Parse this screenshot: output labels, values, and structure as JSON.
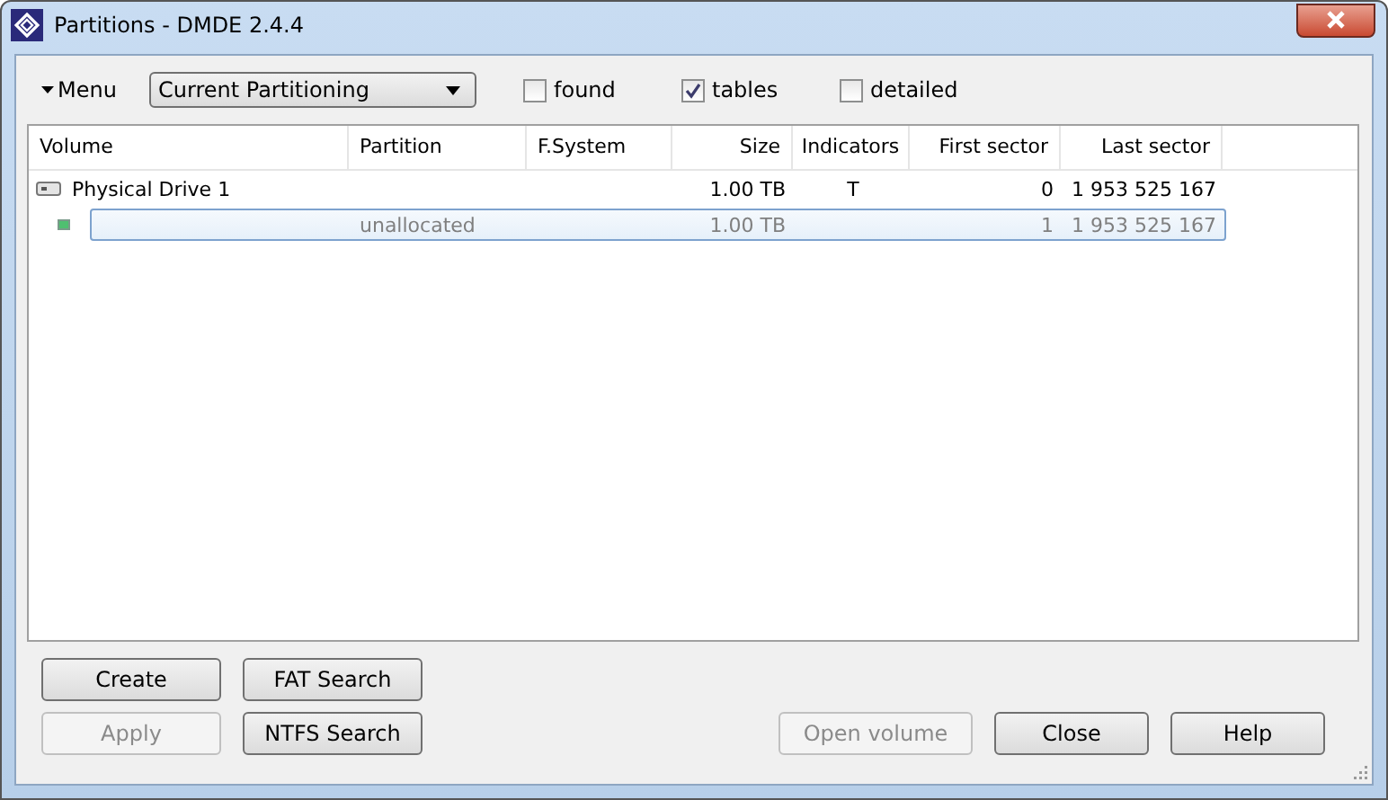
{
  "window": {
    "title": "Partitions - DMDE 2.4.4"
  },
  "toolbar": {
    "menu": "Menu",
    "view": "Current Partitioning",
    "checkboxes": [
      {
        "label": "found",
        "checked": false
      },
      {
        "label": "tables",
        "checked": true
      },
      {
        "label": "detailed",
        "checked": false
      }
    ]
  },
  "table": {
    "columns": [
      "Volume",
      "Partition",
      "F.System",
      "Size",
      "Indicators",
      "First sector",
      "Last sector"
    ],
    "rows": [
      {
        "kind": "drive",
        "selected": false,
        "disabled": false,
        "cells": [
          "Physical Drive 1",
          "",
          "",
          "1.00 TB",
          "T",
          "0",
          "1 953 525 167"
        ],
        "children": [
          {
            "kind": "free",
            "selected": true,
            "disabled": true,
            "cells": [
              "",
              "unallocated",
              "",
              "1.00 TB",
              "",
              "1",
              "1 953 525 167"
            ]
          }
        ]
      }
    ]
  },
  "left_buttons": [
    {
      "label": "Create",
      "disabled": false
    },
    {
      "label": "FAT Search",
      "disabled": false
    },
    {
      "label": "Apply",
      "disabled": true
    },
    {
      "label": "NTFS Search",
      "disabled": false
    }
  ],
  "right_buttons": [
    {
      "label": "Open volume",
      "disabled": true
    },
    {
      "label": "Close",
      "disabled": false
    },
    {
      "label": "Help",
      "disabled": false
    }
  ]
}
